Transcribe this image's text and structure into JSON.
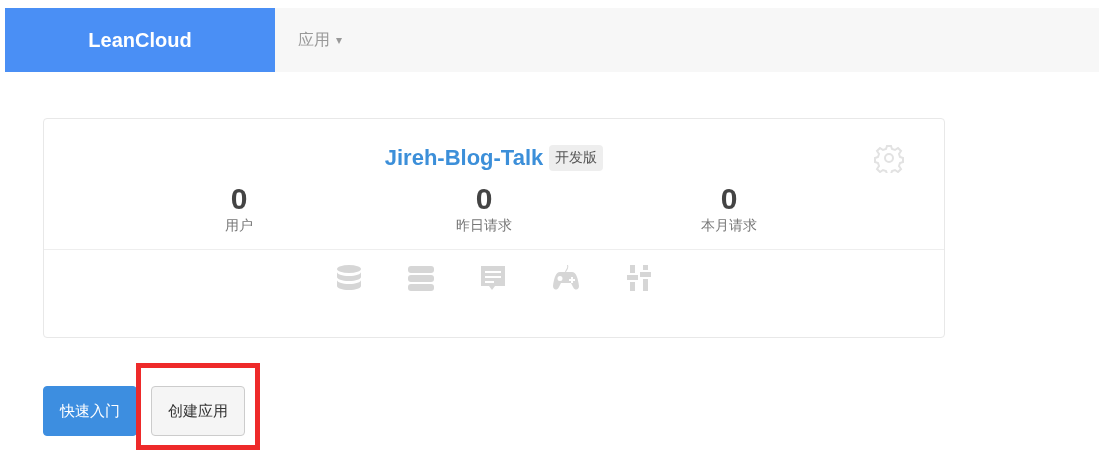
{
  "navbar": {
    "brand": "LeanCloud",
    "menu": {
      "label": "应用",
      "caret": "▾"
    }
  },
  "app_card": {
    "name": "Jireh-Blog-Talk",
    "plan_badge": "开发版",
    "stats": [
      {
        "value": "0",
        "label": "用户"
      },
      {
        "value": "0",
        "label": "昨日请求"
      },
      {
        "value": "0",
        "label": "本月请求"
      }
    ],
    "shortcuts": [
      {
        "kind": "database"
      },
      {
        "kind": "server"
      },
      {
        "kind": "message"
      },
      {
        "kind": "game"
      },
      {
        "kind": "sliders"
      }
    ]
  },
  "buttons": [
    {
      "label": "快速入门",
      "kind": "primary",
      "highlighted": false
    },
    {
      "label": "创建应用",
      "kind": "default",
      "highlighted": true
    }
  ]
}
